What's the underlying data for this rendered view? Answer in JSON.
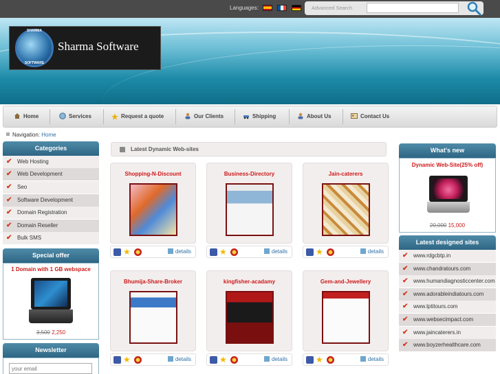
{
  "header": {
    "languages_label": "Languages:",
    "languages": [
      "Spanish",
      "French",
      "German"
    ],
    "advanced_search": "Advanced Search",
    "search_value": ""
  },
  "logo": {
    "text": "Sharma Software",
    "ring_top": "SHARMA",
    "ring_bottom": "SOFTWARE"
  },
  "nav": [
    {
      "label": "Home",
      "icon": "home-icon"
    },
    {
      "label": "Services",
      "icon": "globe-icon"
    },
    {
      "label": "Request a quote",
      "icon": "star-icon"
    },
    {
      "label": "Our Clients",
      "icon": "users-icon"
    },
    {
      "label": "Shipping",
      "icon": "car-icon"
    },
    {
      "label": "About Us",
      "icon": "user-icon"
    },
    {
      "label": "Contact Us",
      "icon": "contact-card-icon"
    }
  ],
  "breadcrumb": {
    "label": "Navigation:",
    "link": "Home"
  },
  "categories": {
    "title": "Categories",
    "items": [
      "Web Hosting",
      "Web Development",
      "Seo",
      "Software Development",
      "Domain Registration",
      "Domain Reseller",
      "Bulk SMS"
    ]
  },
  "special_offer": {
    "title": "Special offer",
    "product": "1 Domain with 1 GB webspace",
    "old_price": "3,500",
    "new_price": "2,250"
  },
  "newsletter": {
    "title": "Newsletter",
    "placeholder": "your email"
  },
  "main": {
    "heading": "Latest Dynamic Web-sites",
    "details_label": "details",
    "cards": [
      "Shopping-N-Discount",
      "Business-Directory",
      "Jain-caterers",
      "Bhumija-Share-Broker",
      "kingfisher-acadamy",
      "Gem-and-Jewellery"
    ]
  },
  "whats_new": {
    "title": "What's new",
    "product": "Dynamic Web-Site(25% off)",
    "old_price": "20,000",
    "new_price": "15,000"
  },
  "latest_sites": {
    "title": "Latest designed sites",
    "items": [
      "www.rdgcbtp.in",
      "www.chandratours.com",
      "www.humandiagnosticcenter.com",
      "www.adorableindiatours.com",
      "www.lptitours.com",
      "www.websecimpact.com",
      "www.jaincaterers.in",
      "www.boyzerhealthcare.com"
    ]
  },
  "colors": {
    "accent_red": "#cc1a1a",
    "panel_blue": "#2e6684",
    "link_blue": "#2f6fa6"
  }
}
